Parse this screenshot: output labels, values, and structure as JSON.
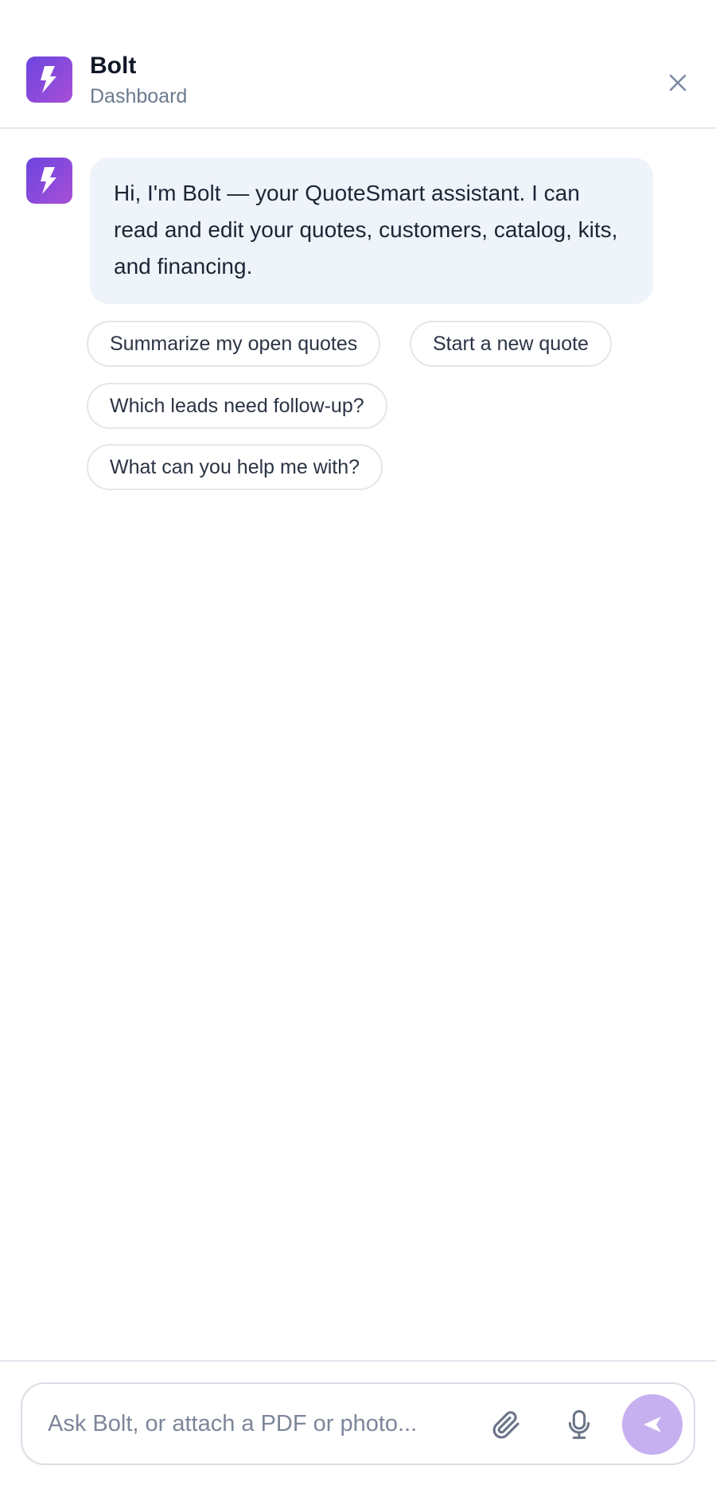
{
  "header": {
    "title": "Bolt",
    "subtitle": "Dashboard",
    "logo_icon": "lightning-bolt-icon",
    "close_icon": "close-icon"
  },
  "conversation": {
    "assistant_message": "Hi, I'm Bolt — your QuoteSmart assistant. I can read and edit your quotes, customers, catalog, kits, and financing.",
    "suggestions": [
      {
        "label": "Summarize my open quotes"
      },
      {
        "label": "Start a new quote"
      },
      {
        "label": "Which leads need follow-up?"
      },
      {
        "label": "What can you help me with?"
      }
    ]
  },
  "composer": {
    "placeholder": "Ask Bolt, or attach a PDF or photo...",
    "value": "",
    "attach_icon": "paperclip-icon",
    "mic_icon": "microphone-icon",
    "send_icon": "send-icon"
  },
  "colors": {
    "brand_gradient_start": "#6c45e0",
    "brand_gradient_end": "#a84fd6",
    "bubble_background": "#eff3fa",
    "send_button": "#c6b0ef",
    "divider": "#e3e7ee"
  }
}
